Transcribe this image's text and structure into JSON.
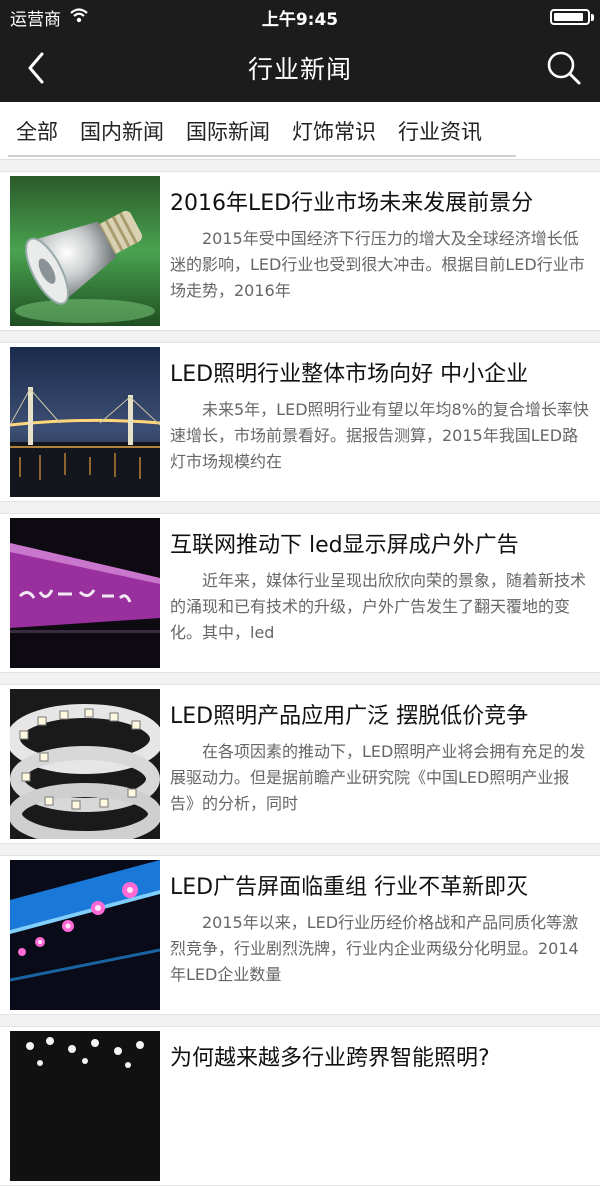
{
  "status_bar": {
    "carrier": "运营商",
    "time": "上午9:45",
    "battery_level": 0.9
  },
  "nav": {
    "title": "行业新闻",
    "back_icon": "chevron-left-icon",
    "search_icon": "search-icon"
  },
  "tabs": [
    "全部",
    "国内新闻",
    "国际新闻",
    "灯饰常识",
    "行业资讯"
  ],
  "articles": [
    {
      "title": "2016年LED行业市场未来发展前景分",
      "summary": "2015年受中国经济下行压力的增大及全球经济增长低迷的影响，LED行业也受到很大冲击。根据目前LED行业市场走势，2016年",
      "image": "led-bulb-image"
    },
    {
      "title": "LED照明行业整体市场向好 中小企业",
      "summary": "未来5年，LED照明行业有望以年均8%的复合增长率快速增长，市场前景看好。据报告测算，2015年我国LED路灯市场规模约在",
      "image": "bridge-night-image"
    },
    {
      "title": "互联网推动下 led显示屏成户外广告",
      "summary": "近年来，媒体行业呈现出欣欣向荣的景象，随着新技术的涌现和已有技术的升级，户外广告发生了翻天覆地的变化。其中，led",
      "image": "led-billboard-image"
    },
    {
      "title": "LED照明产品应用广泛 摆脱低价竞争",
      "summary": "在各项因素的推动下，LED照明产业将会拥有充足的发展驱动力。但是据前瞻产业研究院《中国LED照明产业报告》的分析，同时",
      "image": "led-strip-image"
    },
    {
      "title": "LED广告屏面临重组 行业不革新即灭",
      "summary": "2015年以来，LED行业历经价格战和产品同质化等激烈竞争，行业剧烈洗牌，行业内企业两级分化明显。2014年LED企业数量",
      "image": "ceiling-lights-image"
    },
    {
      "title": "为何越来越多行业跨界智能照明?",
      "summary": "",
      "image": "dot-lights-image"
    }
  ]
}
